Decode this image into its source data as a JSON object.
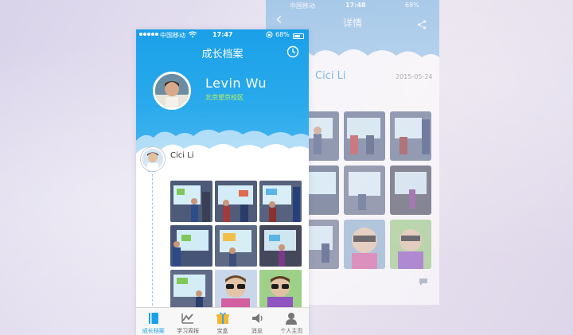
{
  "detail_screen": {
    "status": {
      "carrier": "中国移动",
      "time": "17:48",
      "battery": "68%"
    },
    "title": "详情",
    "author_name": "Cici Li",
    "date": "2015-05-24"
  },
  "main_screen": {
    "status": {
      "carrier": "中国移动",
      "time": "17:47",
      "battery": "68%"
    },
    "title": "成长档案",
    "profile": {
      "name": "Levin Wu",
      "campus": "北京望京校区"
    },
    "post": {
      "author": "Cici Li"
    },
    "tabs": [
      {
        "label": "成长档案",
        "icon": "book-icon",
        "active": true
      },
      {
        "label": "学习周报",
        "icon": "chart-icon",
        "active": false
      },
      {
        "label": "宝盒",
        "icon": "gift-box-icon",
        "active": false
      },
      {
        "label": "消息",
        "icon": "speaker-icon",
        "active": false
      },
      {
        "label": "个人主页",
        "icon": "person-icon",
        "active": false
      }
    ]
  },
  "colors": {
    "header_blue": "#1aa0e8",
    "campus_green": "#c4f55b",
    "active_tab": "#1aa0e8"
  }
}
